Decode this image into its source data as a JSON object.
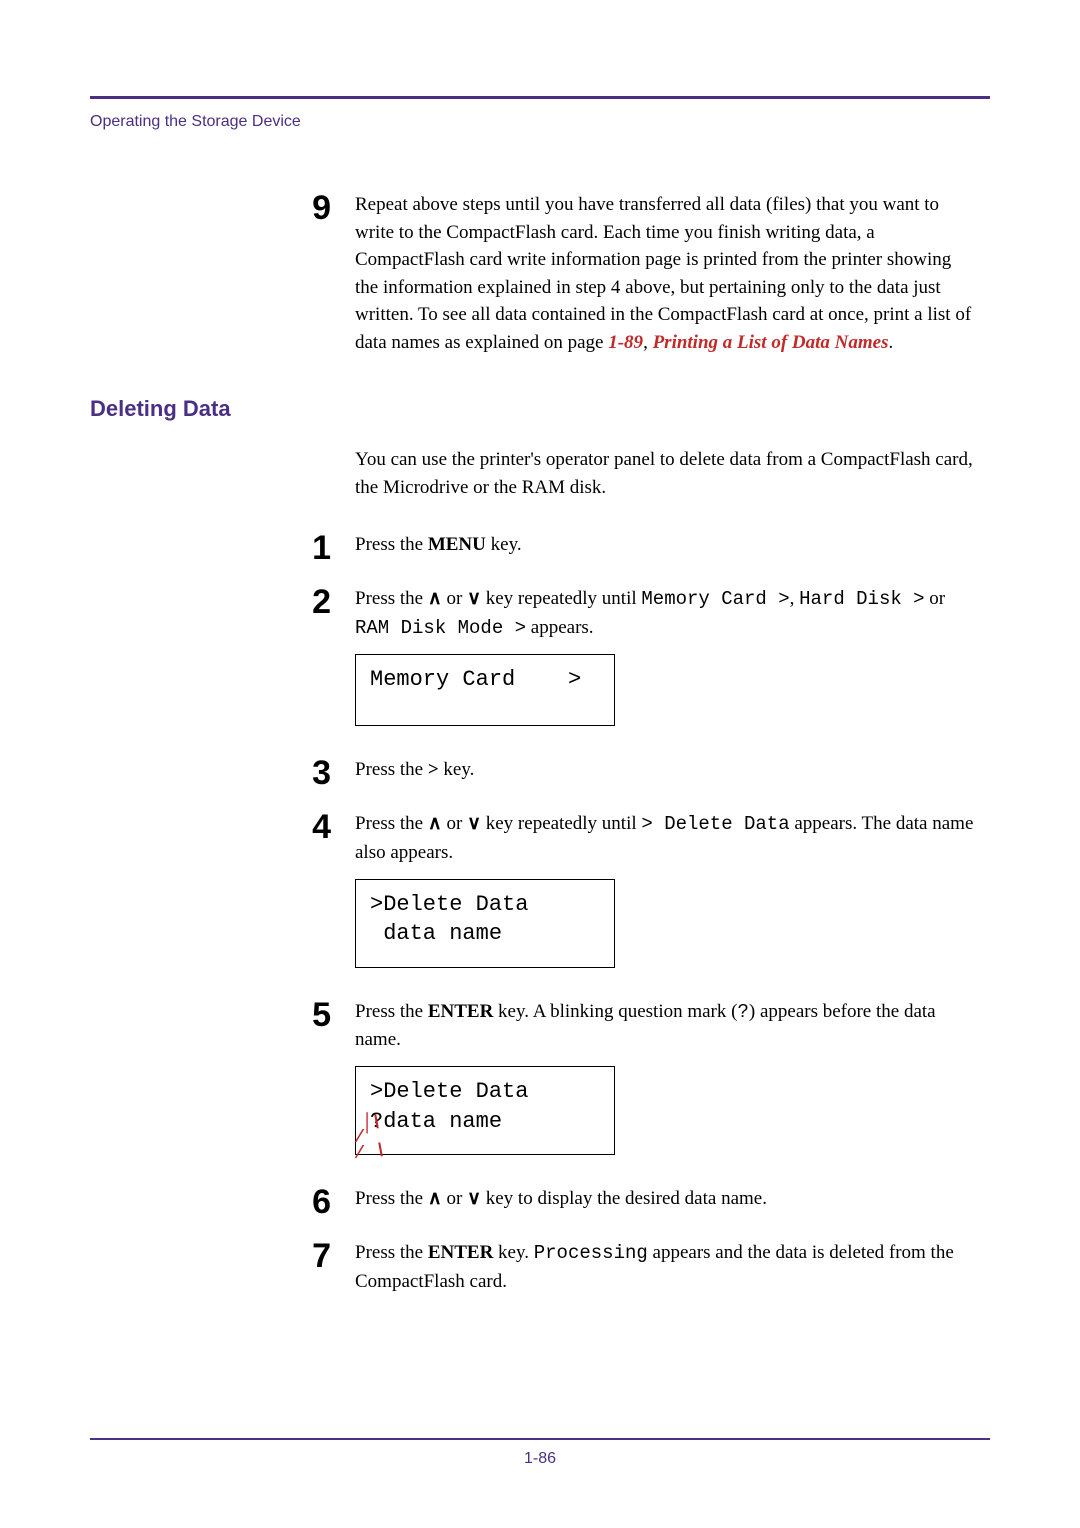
{
  "running_head": "Operating the Storage Device",
  "page_number": "1-86",
  "section_title": "Deleting Data",
  "step9": {
    "num": "9",
    "text_pre": "Repeat above steps until you have transferred all data (files) that you want to write to the CompactFlash card. Each time you finish writing data, a CompactFlash card write information page is printed from the printer showing the information explained in step 4 above, but pertaining only to the data just written. To see all data contained in the CompactFlash card at once, print a list of data names as explained on page ",
    "link_page": "1-89",
    "link_sep": ", ",
    "link_title": "Printing a List of Data Names",
    "tail": "."
  },
  "intro": "You can use the printer's operator panel to delete data from a CompactFlash card, the Microdrive or the RAM disk.",
  "step1": {
    "num": "1",
    "t1": "Press the ",
    "b1": "MENU",
    "t2": " key."
  },
  "step2": {
    "num": "2",
    "t1": "Press the ",
    "up": "∧",
    "mid1": " or ",
    "down": "∨",
    "t2": " key repeatedly until ",
    "m1": "Memory Card >",
    "m1b": ", ",
    "m2": "Hard Disk >",
    "m2b": " or ",
    "m3": "RAM Disk Mode >",
    "t3": " appears."
  },
  "lcd1_line1": "Memory Card    >",
  "step3": {
    "num": "3",
    "t1": "Press the ",
    "b1": ">",
    "t2": " key."
  },
  "step4": {
    "num": "4",
    "t1": "Press the ",
    "up": "∧",
    "mid1": " or ",
    "down": "∨",
    "t2": " key repeatedly until ",
    "m1": "> Delete Data",
    "t3": " appears. The data name also appears."
  },
  "lcd2_line1": ">Delete Data",
  "lcd2_line2": " data name",
  "step5": {
    "num": "5",
    "t1": "Press the ",
    "b1": "ENTER",
    "t2": " key. A blinking question mark (",
    "m1": "?",
    "t3": ") appears before the data name."
  },
  "lcd3_line1": ">Delete Data",
  "lcd3_line2": "?data name",
  "step6": {
    "num": "6",
    "t1": "Press the ",
    "up": "∧",
    "mid1": " or ",
    "down": "∨",
    "t2": " key to display the desired data name."
  },
  "step7": {
    "num": "7",
    "t1": "Press the ",
    "b1": "ENTER",
    "t2": " key. ",
    "m1": "Processing",
    "t3": " appears and the data is deleted from the CompactFlash card."
  }
}
